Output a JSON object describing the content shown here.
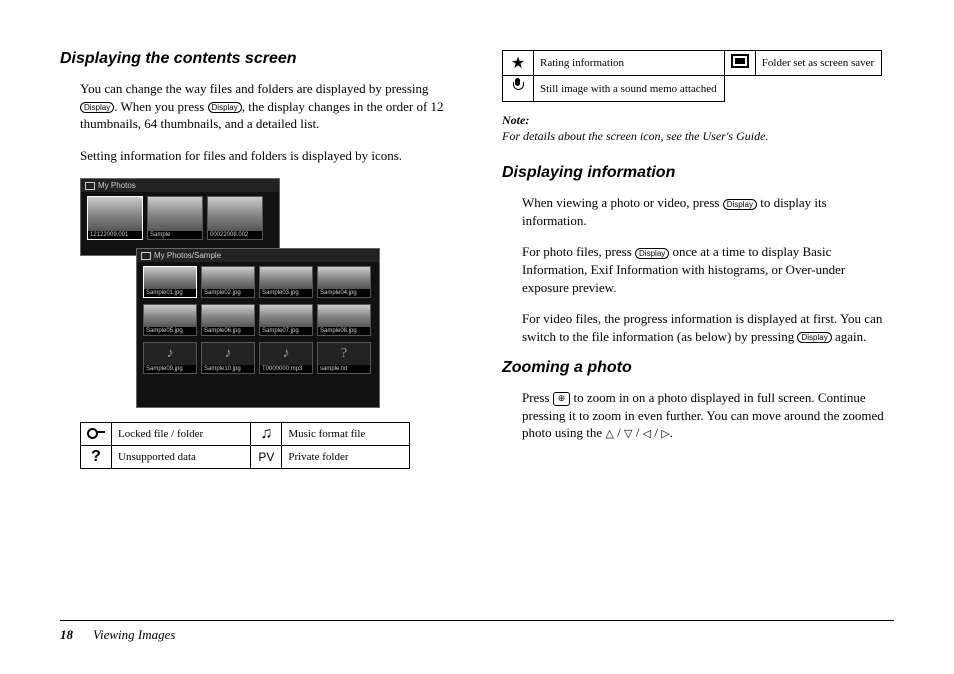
{
  "left": {
    "heading": "Displaying the contents screen",
    "para1a": "You can change the way files and folders are displayed by pressing ",
    "para1b": ". When you press ",
    "para1c": ", the display changes in the order of 12 thumbnails, 64 thumbnails, and a detailed list.",
    "para2": "Setting information for files and folders is displayed by icons.",
    "display_label": "Display",
    "screen_top_title": "My Photos",
    "screen_bot_title": "My Photos/Sample",
    "top_thumbs": [
      "12122009.001",
      "Sample",
      "00022008.002"
    ],
    "bot_thumbs": [
      "Sample01.jpg",
      "Sample02.jpg",
      "Sample03.jpg",
      "Sample04.jpg",
      "Sample05.jpg",
      "Sample06.jpg",
      "Sample07.jpg",
      "Sample08.jpg",
      "Sample09.jpg",
      "Sample10.jpg",
      "T0000000.mp3",
      "sample.txt"
    ],
    "table": [
      {
        "icon": "key",
        "label": "Locked file / folder",
        "icon2": "music",
        "label2": "Music format file"
      },
      {
        "icon": "question",
        "label": "Unsupported data",
        "icon2": "pv",
        "label2": "Private folder"
      }
    ]
  },
  "right": {
    "table": [
      {
        "icon": "star",
        "label": "Rating information",
        "icon2": "saver",
        "label2": "Folder set as screen saver"
      },
      {
        "icon": "mic",
        "label": "Still image with a sound memo attached"
      }
    ],
    "note_label": "Note:",
    "note_body": "For details about the screen icon, see the User's Guide.",
    "h2a": "Displaying information",
    "pa1a": "When viewing a photo or video, press ",
    "pa1b": " to display its information.",
    "pa2a": "For photo files, press ",
    "pa2b": " once at a time to display Basic Information, Exif Information with histograms, or Over-under exposure preview.",
    "pa3a": "For video files, the progress information is displayed at first. You can switch to the file information (as below) by pressing ",
    "pa3b": " again.",
    "h2b": "Zooming a photo",
    "pb1a": "Press ",
    "pb1b": " to zoom in on a photo displayed in full screen. Continue pressing it to zoom in even further. You can move around the zoomed photo using the ",
    "pb1c": ".",
    "zoom_label": "⊕",
    "display_label": "Display"
  },
  "footer": {
    "page": "18",
    "section": "Viewing Images"
  }
}
